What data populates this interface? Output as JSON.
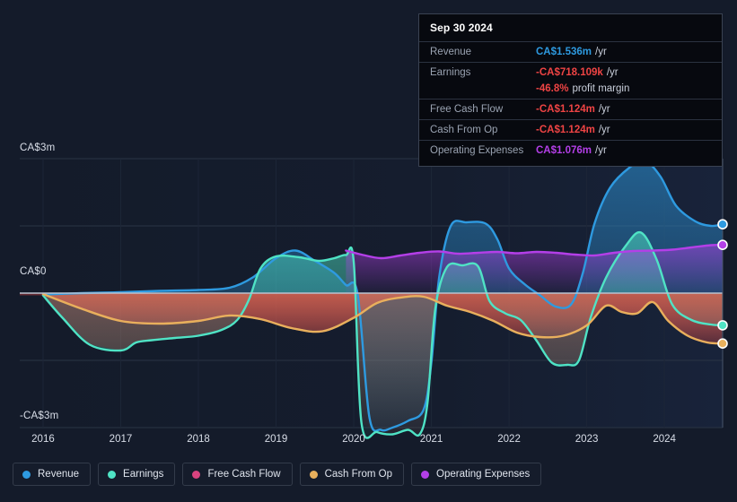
{
  "tooltip": {
    "date": "Sep 30 2024",
    "rows": [
      {
        "label": "Revenue",
        "value": "CA$1.536m",
        "unit": "/yr",
        "color": "#2e9ae0"
      },
      {
        "label": "Earnings",
        "value": "-CA$718.109k",
        "unit": "/yr",
        "color": "#ef4444"
      },
      {
        "label": "",
        "value": "-46.8%",
        "unit": "profit margin",
        "color": "#ef4444",
        "sub": true
      },
      {
        "label": "Free Cash Flow",
        "value": "-CA$1.124m",
        "unit": "/yr",
        "color": "#ef4444"
      },
      {
        "label": "Cash From Op",
        "value": "-CA$1.124m",
        "unit": "/yr",
        "color": "#ef4444"
      },
      {
        "label": "Operating Expenses",
        "value": "CA$1.076m",
        "unit": "/yr",
        "color": "#b43fe8"
      }
    ]
  },
  "axis": {
    "y_top_label": "CA$3m",
    "y_zero_label": "CA$0",
    "y_bottom_label": "-CA$3m"
  },
  "legend": [
    {
      "label": "Revenue",
      "color": "#2e9ae0"
    },
    {
      "label": "Earnings",
      "color": "#4fe3c5"
    },
    {
      "label": "Free Cash Flow",
      "color": "#d8437f"
    },
    {
      "label": "Cash From Op",
      "color": "#e8b05c"
    },
    {
      "label": "Operating Expenses",
      "color": "#b43fe8"
    }
  ],
  "chart_data": {
    "type": "area",
    "title": "",
    "xlabel": "",
    "ylabel": "CA$",
    "currency": "CA$",
    "xlim": [
      2015.7,
      2024.75
    ],
    "ylim": [
      -3.2,
      3.2
    ],
    "yticks": [
      3,
      0,
      -3
    ],
    "ytick_labels": [
      "CA$3m",
      "CA$0",
      "-CA$3m"
    ],
    "xticks": [
      2016,
      2017,
      2018,
      2019,
      2020,
      2021,
      2022,
      2023,
      2024
    ],
    "xtick_labels": [
      "2016",
      "2017",
      "2018",
      "2019",
      "2020",
      "2021",
      "2022",
      "2023",
      "2024"
    ],
    "grid": true,
    "legend_position": "bottom",
    "units": "millions CA$ (per year, trailing twelve months)",
    "series": [
      {
        "name": "Revenue",
        "color": "#2e9ae0",
        "x": [
          2016.0,
          2016.5,
          2017.0,
          2017.5,
          2018.0,
          2018.4,
          2018.7,
          2019.0,
          2019.25,
          2019.5,
          2019.75,
          2019.9,
          2020.05,
          2020.2,
          2020.35,
          2020.5,
          2020.7,
          2020.9,
          2021.0,
          2021.1,
          2021.25,
          2021.45,
          2021.7,
          2021.85,
          2022.0,
          2022.2,
          2022.4,
          2022.6,
          2022.8,
          2022.95,
          2023.1,
          2023.3,
          2023.55,
          2023.75,
          2023.95,
          2024.15,
          2024.4,
          2024.6,
          2024.75
        ],
        "y": [
          -0.03,
          0.0,
          0.02,
          0.05,
          0.07,
          0.12,
          0.35,
          0.78,
          0.95,
          0.72,
          0.45,
          0.18,
          -0.02,
          -2.75,
          -3.05,
          -3.0,
          -2.85,
          -2.6,
          -1.55,
          0.35,
          1.5,
          1.58,
          1.55,
          1.2,
          0.55,
          0.2,
          -0.05,
          -0.3,
          -0.25,
          0.45,
          1.55,
          2.35,
          2.8,
          2.95,
          2.6,
          1.95,
          1.6,
          1.5,
          1.536
        ]
      },
      {
        "name": "Earnings",
        "color": "#4fe3c5",
        "x": [
          2016.0,
          2016.25,
          2016.6,
          2017.0,
          2017.2,
          2017.4,
          2017.7,
          2018.0,
          2018.3,
          2018.5,
          2018.65,
          2018.8,
          2019.0,
          2019.3,
          2019.55,
          2019.75,
          2019.9,
          2020.0,
          2020.1,
          2020.3,
          2020.5,
          2020.7,
          2020.85,
          2020.95,
          2021.05,
          2021.2,
          2021.4,
          2021.6,
          2021.75,
          2021.95,
          2022.15,
          2022.35,
          2022.55,
          2022.75,
          2022.9,
          2023.05,
          2023.25,
          2023.5,
          2023.7,
          2023.9,
          2024.1,
          2024.35,
          2024.6,
          2024.75
        ],
        "y": [
          -0.05,
          -0.55,
          -1.15,
          -1.28,
          -1.1,
          -1.05,
          -1.0,
          -0.95,
          -0.82,
          -0.6,
          -0.15,
          0.55,
          0.82,
          0.8,
          0.72,
          0.78,
          0.85,
          0.7,
          -2.9,
          -3.1,
          -3.15,
          -3.05,
          -3.15,
          -2.45,
          -0.35,
          0.58,
          0.62,
          0.6,
          -0.18,
          -0.45,
          -0.6,
          -1.05,
          -1.55,
          -1.6,
          -1.5,
          -0.55,
          0.35,
          1.05,
          1.35,
          0.75,
          -0.25,
          -0.6,
          -0.7,
          -0.718
        ]
      },
      {
        "name": "Free Cash Flow",
        "color": "#d8437f",
        "x": [
          2016.0,
          2016.5,
          2017.0,
          2017.5,
          2018.0,
          2018.4,
          2018.8,
          2019.2,
          2019.6,
          2020.0,
          2020.3,
          2020.6,
          2020.9,
          2021.2,
          2021.5,
          2021.8,
          2022.1,
          2022.4,
          2022.7,
          2023.0,
          2023.25,
          2023.45,
          2023.65,
          2023.85,
          2024.05,
          2024.3,
          2024.55,
          2024.75
        ],
        "y": [
          -0.02,
          -0.35,
          -0.62,
          -0.68,
          -0.62,
          -0.5,
          -0.58,
          -0.78,
          -0.85,
          -0.55,
          -0.22,
          -0.1,
          -0.08,
          -0.28,
          -0.42,
          -0.62,
          -0.88,
          -0.98,
          -0.95,
          -0.72,
          -0.28,
          -0.42,
          -0.45,
          -0.2,
          -0.62,
          -0.95,
          -1.1,
          -1.124
        ]
      },
      {
        "name": "Cash From Op",
        "color": "#e8b05c",
        "x": [
          2016.0,
          2016.5,
          2017.0,
          2017.5,
          2018.0,
          2018.4,
          2018.8,
          2019.2,
          2019.6,
          2020.0,
          2020.3,
          2020.6,
          2020.9,
          2021.2,
          2021.5,
          2021.8,
          2022.1,
          2022.4,
          2022.7,
          2023.0,
          2023.25,
          2023.45,
          2023.65,
          2023.85,
          2024.05,
          2024.3,
          2024.55,
          2024.75
        ],
        "y": [
          -0.02,
          -0.35,
          -0.62,
          -0.68,
          -0.62,
          -0.5,
          -0.58,
          -0.78,
          -0.85,
          -0.55,
          -0.22,
          -0.1,
          -0.08,
          -0.28,
          -0.42,
          -0.62,
          -0.88,
          -0.98,
          -0.95,
          -0.72,
          -0.28,
          -0.42,
          -0.45,
          -0.2,
          -0.62,
          -0.95,
          -1.1,
          -1.124
        ]
      },
      {
        "name": "Operating Expenses",
        "color": "#b43fe8",
        "x": [
          2019.9,
          2020.1,
          2020.35,
          2020.6,
          2020.85,
          2021.1,
          2021.35,
          2021.6,
          2021.85,
          2022.1,
          2022.35,
          2022.6,
          2022.85,
          2023.1,
          2023.35,
          2023.6,
          2023.85,
          2024.1,
          2024.35,
          2024.6,
          2024.75
        ],
        "y": [
          0.95,
          0.86,
          0.78,
          0.84,
          0.9,
          0.93,
          0.88,
          0.9,
          0.92,
          0.89,
          0.92,
          0.9,
          0.86,
          0.84,
          0.9,
          0.94,
          0.95,
          0.97,
          1.02,
          1.07,
          1.076
        ]
      }
    ],
    "end_markers": [
      {
        "name": "Revenue",
        "value": 1.536,
        "color": "#2e9ae0"
      },
      {
        "name": "Operating Expenses",
        "value": 1.076,
        "color": "#b43fe8"
      },
      {
        "name": "Earnings",
        "value": -0.718,
        "color": "#4fe3c5"
      },
      {
        "name": "Cash From Op",
        "value": -1.124,
        "color": "#e8b05c"
      }
    ]
  }
}
